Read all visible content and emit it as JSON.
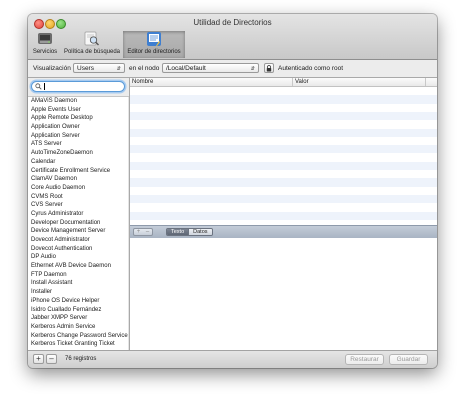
{
  "window": {
    "title": "Utilidad de Directorios"
  },
  "toolbar": {
    "items": [
      {
        "label": "Servicios",
        "icon": "services-icon",
        "selected": false
      },
      {
        "label": "Política de búsqueda",
        "icon": "search-policy-icon",
        "selected": false
      },
      {
        "label": "Editor de directorios",
        "icon": "directory-editor-icon",
        "selected": true
      }
    ]
  },
  "nodebar": {
    "view_label": "Visualización",
    "view_value": "Users",
    "node_label": "en el nodo",
    "node_value": "/Local/Default",
    "auth_label": "Autenticado como root"
  },
  "search": {
    "value": ""
  },
  "records": [
    "AMaViS Daemon",
    "Apple Events User",
    "Apple Remote Desktop",
    "Application Owner",
    "Application Server",
    "ATS Server",
    "AutoTimeZoneDaemon",
    "Calendar",
    "Certificate Enrollment Service",
    "ClamAV Daemon",
    "Core Audio Daemon",
    "CVMS Root",
    "CVS Server",
    "Cyrus Administrator",
    "Developer Documentation",
    "Device Management Server",
    "Dovecot Administrator",
    "Dovecot Authentication",
    "DP Audio",
    "Ethernet AVB Device Daemon",
    "FTP Daemon",
    "Install Assistant",
    "Installer",
    "iPhone OS Device Helper",
    "Isidro Cuallado Fernández",
    "Jabber XMPP Server",
    "Kerberos Admin Service",
    "Kerberos Change Password Service",
    "Kerberos Ticket Granting Ticket"
  ],
  "table": {
    "col_name": "Nombre",
    "col_value": "Valor"
  },
  "editor": {
    "mode_text": "Texto",
    "mode_data": "Datos"
  },
  "bottom": {
    "count": "76 registros",
    "restore": "Restaurar",
    "save": "Guardar"
  },
  "colors": {
    "accent": "#5b9bd8",
    "stripe": "#eef3fb"
  }
}
